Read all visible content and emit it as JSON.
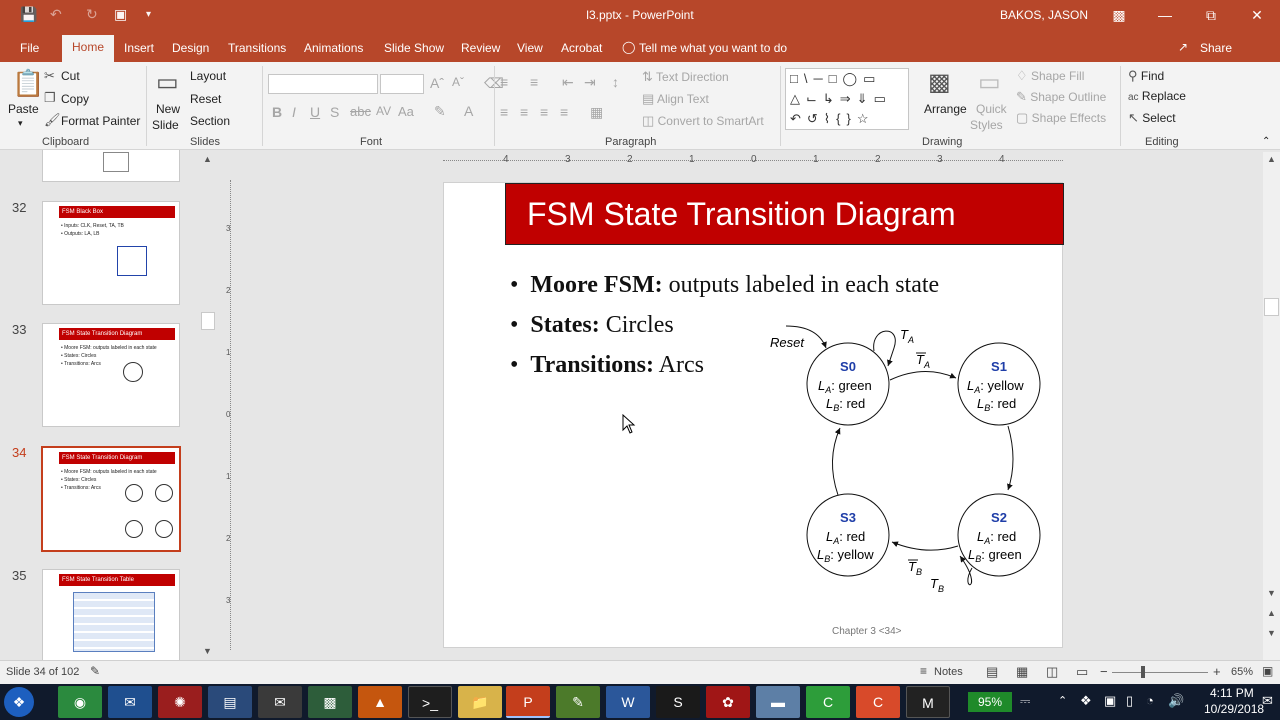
{
  "window": {
    "doc_title": "l3.pptx  -  PowerPoint",
    "user": "BAKOS, JASON"
  },
  "ribbon_tabs": [
    "File",
    "Home",
    "Insert",
    "Design",
    "Transitions",
    "Animations",
    "Slide Show",
    "Review",
    "View",
    "Acrobat"
  ],
  "tell_me": "Tell me what you want to do",
  "share": "Share",
  "clipboard": {
    "paste": "Paste",
    "cut": "Cut",
    "copy": "Copy",
    "format_painter": "Format Painter",
    "group": "Clipboard"
  },
  "slides_group": {
    "new_slide_1": "New",
    "new_slide_2": "Slide",
    "layout": "Layout",
    "reset": "Reset",
    "section": "Section",
    "group": "Slides"
  },
  "font_group": {
    "group": "Font"
  },
  "paragraph_group": {
    "text_direction": "Text Direction",
    "align_text": "Align Text",
    "convert": "Convert to SmartArt",
    "group": "Paragraph"
  },
  "drawing_group": {
    "arrange": "Arrange",
    "quick_1": "Quick",
    "quick_2": "Styles",
    "shape_fill": "Shape Fill",
    "shape_outline": "Shape Outline",
    "shape_effects": "Shape Effects",
    "group": "Drawing"
  },
  "editing_group": {
    "find": "Find",
    "replace": "Replace",
    "select": "Select",
    "group": "Editing"
  },
  "thumbnails": [
    {
      "num": "32",
      "title": "FSM Black Box",
      "lines": [
        "• Inputs: CLK, Reset, TA, TB",
        "• Outputs: LA, LB"
      ]
    },
    {
      "num": "33",
      "title": "FSM State Transition Diagram",
      "lines": [
        "• Moore FSM: outputs labeled in each state",
        "• States: Circles",
        "• Transitions: Arcs"
      ]
    },
    {
      "num": "34",
      "title": "FSM State Transition Diagram",
      "lines": [
        "• Moore FSM: outputs labeled in each state",
        "• States: Circles",
        "• Transitions: Arcs"
      ]
    },
    {
      "num": "35",
      "title": "FSM State Transition Table",
      "lines": []
    }
  ],
  "slide": {
    "title": "FSM State Transition Diagram",
    "bullets": [
      {
        "bold": "Moore FSM:",
        "rest": " outputs labeled in each state"
      },
      {
        "bold": "States:",
        "rest": " Circles"
      },
      {
        "bold": "Transitions:",
        "rest": " Arcs"
      }
    ],
    "footer": "Chapter 3 <34>",
    "diagram": {
      "reset": "Reset",
      "states": [
        {
          "name": "S0",
          "l1": ": green",
          "l2": ": red"
        },
        {
          "name": "S1",
          "l1": ": yellow",
          "l2": ": red"
        },
        {
          "name": "S2",
          "l1": ": red",
          "l2": ": green"
        },
        {
          "name": "S3",
          "l1": ": red",
          "l2": ": yellow"
        }
      ],
      "la": "L",
      "lb": "L",
      "sub_a": "A",
      "sub_b": "B",
      "ta": "T",
      "tb": "T"
    }
  },
  "ruler_top": [
    "4",
    "3",
    "2",
    "1",
    "0",
    "1",
    "2",
    "3",
    "4"
  ],
  "ruler_left": [
    "3",
    "2",
    "1",
    "0",
    "1",
    "2",
    "3"
  ],
  "status": {
    "slide_of": "Slide 34 of 102",
    "notes": "Notes",
    "zoom": "65%"
  },
  "taskbar": {
    "battery": "95%",
    "time": "4:11 PM",
    "date": "10/29/2018"
  }
}
